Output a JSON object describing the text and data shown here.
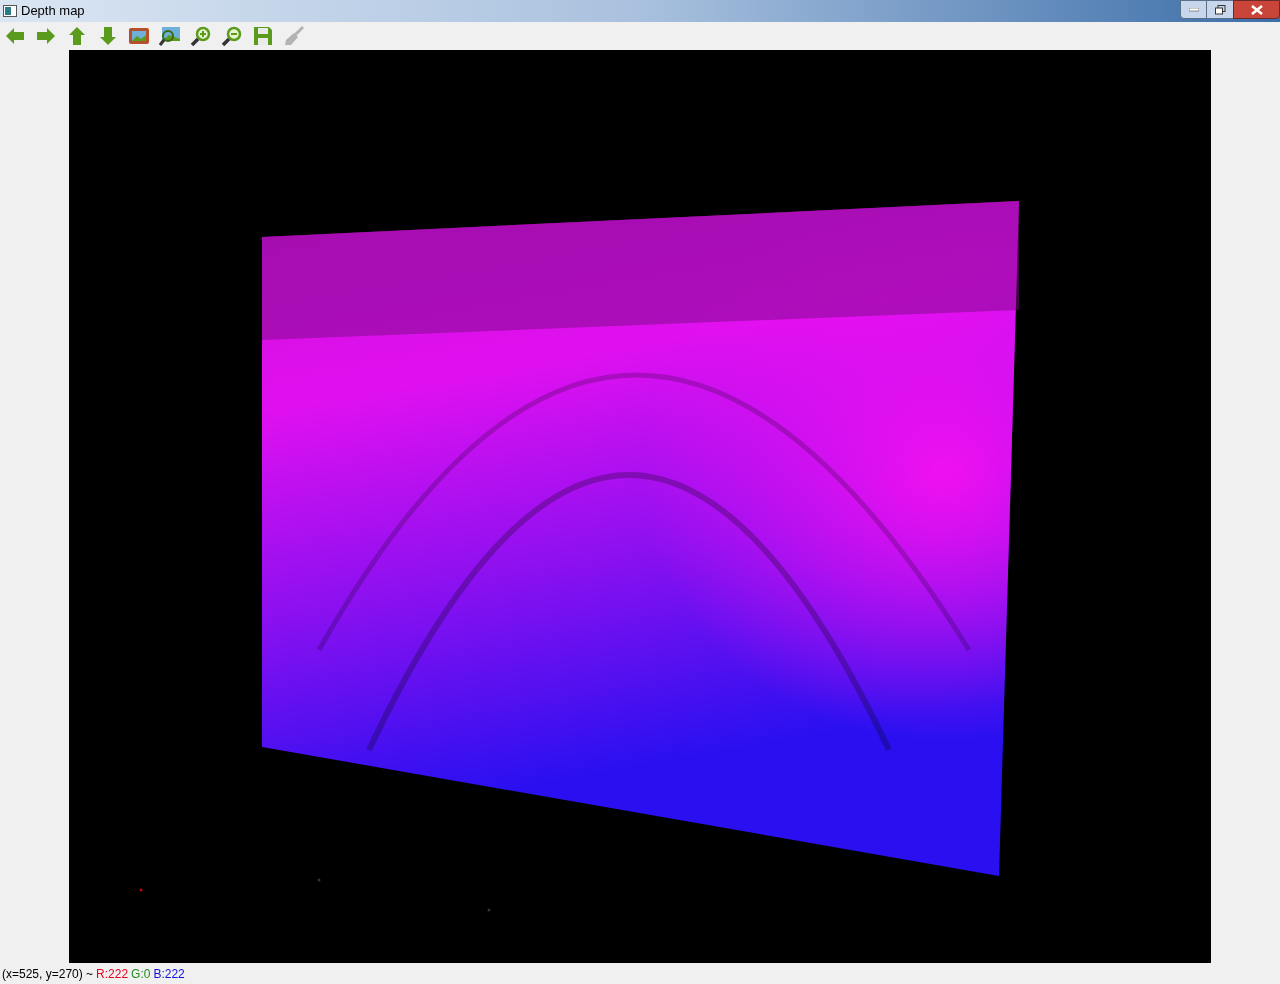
{
  "window": {
    "title": "Depth map"
  },
  "toolbar": [
    {
      "kind": "left",
      "disabled": false
    },
    {
      "kind": "right",
      "disabled": false
    },
    {
      "kind": "up",
      "disabled": false
    },
    {
      "kind": "down",
      "disabled": false
    },
    {
      "kind": "fit",
      "disabled": false
    },
    {
      "kind": "zoomrect",
      "disabled": false
    },
    {
      "kind": "zoomin",
      "disabled": false
    },
    {
      "kind": "zoomout",
      "disabled": false
    },
    {
      "kind": "save",
      "disabled": false
    },
    {
      "kind": "clear",
      "disabled": true
    }
  ],
  "status_bar": {
    "position": "(x=525, y=270) ~",
    "channels": [
      {
        "text": "R:222",
        "color": "#e8001c"
      },
      {
        "text": "G:0",
        "color": "#1e8c1e"
      },
      {
        "text": "B:222",
        "color": "#1010e0"
      }
    ]
  }
}
